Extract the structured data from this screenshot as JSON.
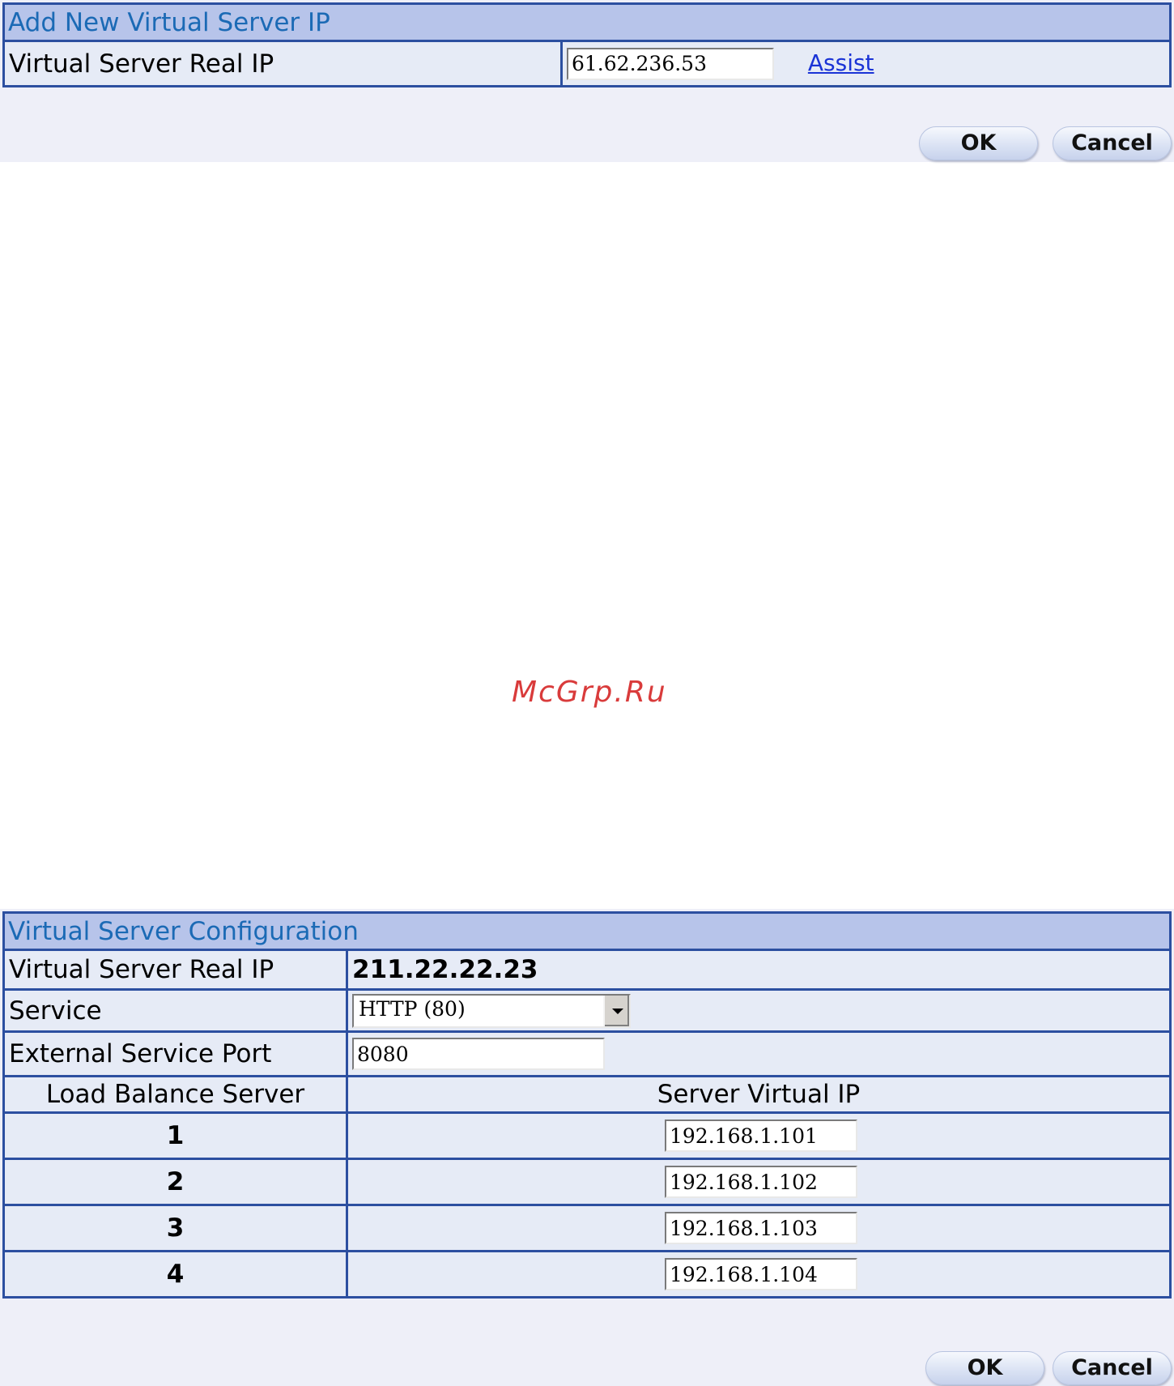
{
  "add_panel": {
    "title": "Add New Virtual Server IP",
    "real_ip_label": "Virtual Server Real IP",
    "real_ip_value": "61.62.236.53",
    "assist_label": "Assist",
    "ok_label": "OK",
    "cancel_label": "Cancel"
  },
  "watermark": "McGrp.Ru",
  "config_panel": {
    "title": "Virtual Server Configuration",
    "real_ip_label": "Virtual Server Real IP",
    "real_ip_value": "211.22.22.23",
    "service_label": "Service",
    "service_value": "HTTP (80)",
    "ext_port_label": "External Service Port",
    "ext_port_value": "8080",
    "lb_header": "Load Balance Server",
    "vip_header": "Server Virtual IP",
    "servers": [
      {
        "index": "1",
        "ip": "192.168.1.101"
      },
      {
        "index": "2",
        "ip": "192.168.1.102"
      },
      {
        "index": "3",
        "ip": "192.168.1.103"
      },
      {
        "index": "4",
        "ip": "192.168.1.104"
      }
    ],
    "ok_label": "OK",
    "cancel_label": "Cancel"
  }
}
